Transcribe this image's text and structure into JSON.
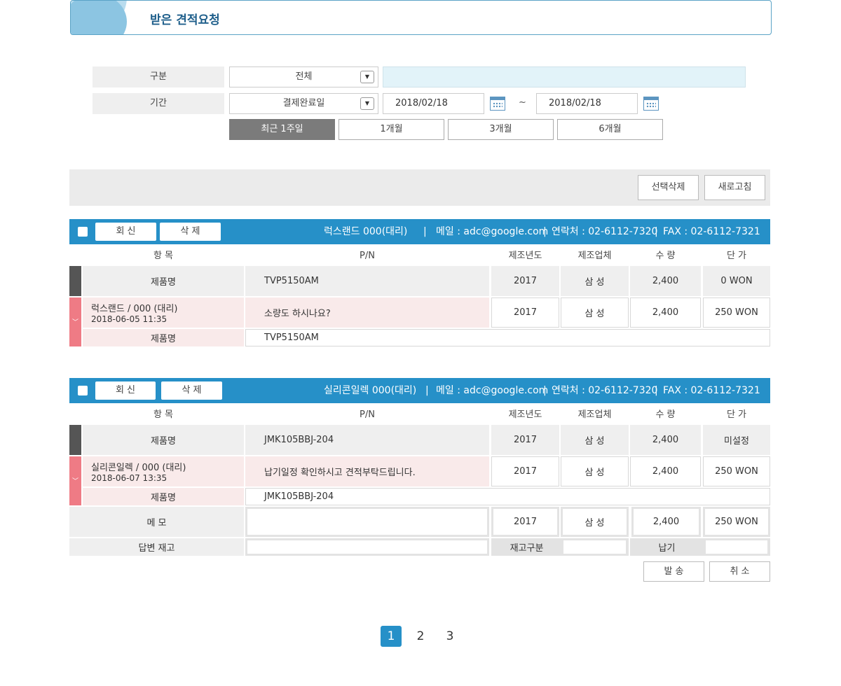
{
  "header": {
    "title": "받은 견적요청"
  },
  "filters": {
    "category_label": "구분",
    "category_value": "전체",
    "period_label": "기간",
    "period_type_value": "결제완료일",
    "date_from": "2018/02/18",
    "date_separator": "~",
    "date_to": "2018/02/18",
    "quick_periods": [
      "최근 1주일",
      "1개월",
      "3개월",
      "6개월"
    ],
    "active_period_index": 0
  },
  "actions": {
    "delete_selected": "선택삭제",
    "refresh": "새로고침"
  },
  "columns": [
    "항 목",
    "P/N",
    "제조년도",
    "제조업체",
    "수 량",
    "단 가"
  ],
  "quotes": [
    {
      "reply_label": "회 신",
      "delete_label": "삭 제",
      "company": "럭스랜드 000(대리)",
      "separator": "|",
      "email": "메일 : adc@google.com",
      "phone": "연락처 : 02-6112-7320",
      "fax": "FAX : 02-6112-7321",
      "product_row": {
        "label": "제품명",
        "pn": "TVP5150AM",
        "year": "2017",
        "maker": "삼 성",
        "qty": "2,400",
        "price": "0 WON"
      },
      "request_row": {
        "requester": "럭스랜드 / 000 (대리)",
        "datetime": "2018-06-05 11:35",
        "message": "소량도 하시나요?",
        "year": "2017",
        "maker": "삼 성",
        "qty": "2,400",
        "price": "250 WON"
      },
      "product_name_row": {
        "label": "제품명",
        "value": "TVP5150AM"
      }
    },
    {
      "reply_label": "회 신",
      "delete_label": "삭 제",
      "company": "실리콘일렉 000(대리)",
      "separator": "|",
      "email": "메일 : adc@google.com",
      "phone": "연락처 : 02-6112-7320",
      "fax": "FAX : 02-6112-7321",
      "product_row": {
        "label": "제품명",
        "pn": "JMK105BBJ-204",
        "year": "2017",
        "maker": "삼 성",
        "qty": "2,400",
        "price": "미설정"
      },
      "request_row": {
        "requester": "실리콘일렉 / 000 (대리)",
        "datetime": "2018-06-07 13:35",
        "message": "납기일정 확인하시고 견적부탁드립니다.",
        "year": "2017",
        "maker": "삼 성",
        "qty": "2,400",
        "price": "250 WON"
      },
      "product_name_row": {
        "label": "제품명",
        "value": "JMK105BBJ-204"
      },
      "memo_row": {
        "label": "메 모",
        "memo_value": "",
        "year": "2017",
        "maker": "삼 성",
        "qty": "2,400",
        "price": "250 WON"
      },
      "stock_row": {
        "label": "답변 재고",
        "stock_type_label": "재고구분",
        "delivery_label": "납기"
      },
      "send_label": "발 송",
      "cancel_label": "취 소"
    }
  ],
  "pagination": {
    "pages": [
      "1",
      "2",
      "3"
    ],
    "active_index": 0
  },
  "colors": {
    "primary": "#2690c8",
    "pink_accent": "#ef7b85",
    "dark_accent": "#555555",
    "active_period": "#7b7b7b"
  }
}
